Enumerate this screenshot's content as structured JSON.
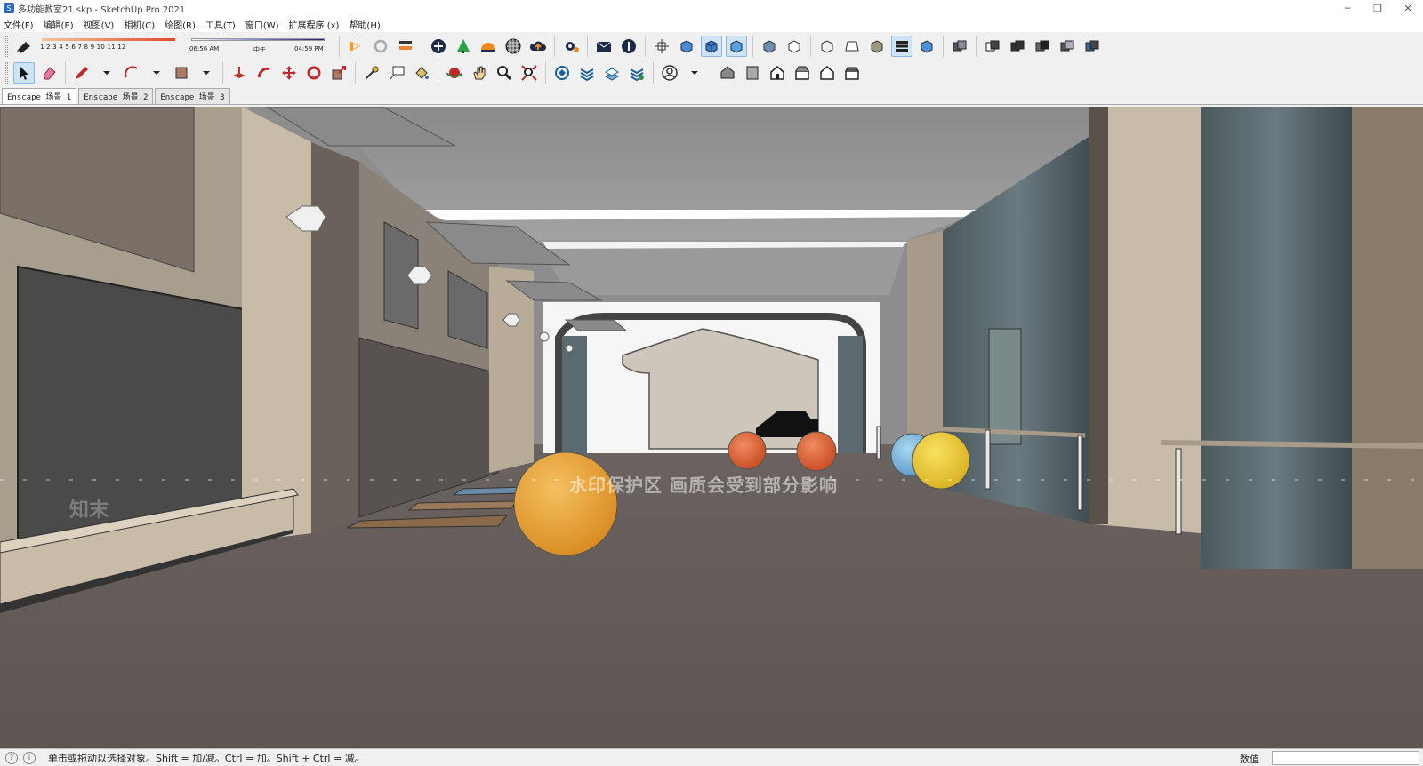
{
  "window": {
    "title": "多功能教室21.skp - SketchUp Pro 2021",
    "controls": [
      "─",
      "❐",
      "✕"
    ]
  },
  "menu": [
    "文件(F)",
    "编辑(E)",
    "视图(V)",
    "相机(C)",
    "绘图(R)",
    "工具(T)",
    "窗口(W)",
    "扩展程序 (x)",
    "帮助(H)"
  ],
  "shadow": {
    "months": "1 2 3 4 5 6 7 8 9 10 11 12",
    "time_start": "06:56 AM",
    "time_mid": "中午",
    "time_end": "04:59 PM"
  },
  "scenes": [
    "Enscape 场景 1",
    "Enscape 场景 2",
    "Enscape 场景 3"
  ],
  "viewport": {
    "watermark": "水印保护区   画质会受到部分影响",
    "brand_mark": "知末"
  },
  "status": {
    "hint": "单击或拖动以选择对象。Shift = 加/减。Ctrl = 加。Shift + Ctrl = 减。",
    "measure_label": "数值"
  }
}
